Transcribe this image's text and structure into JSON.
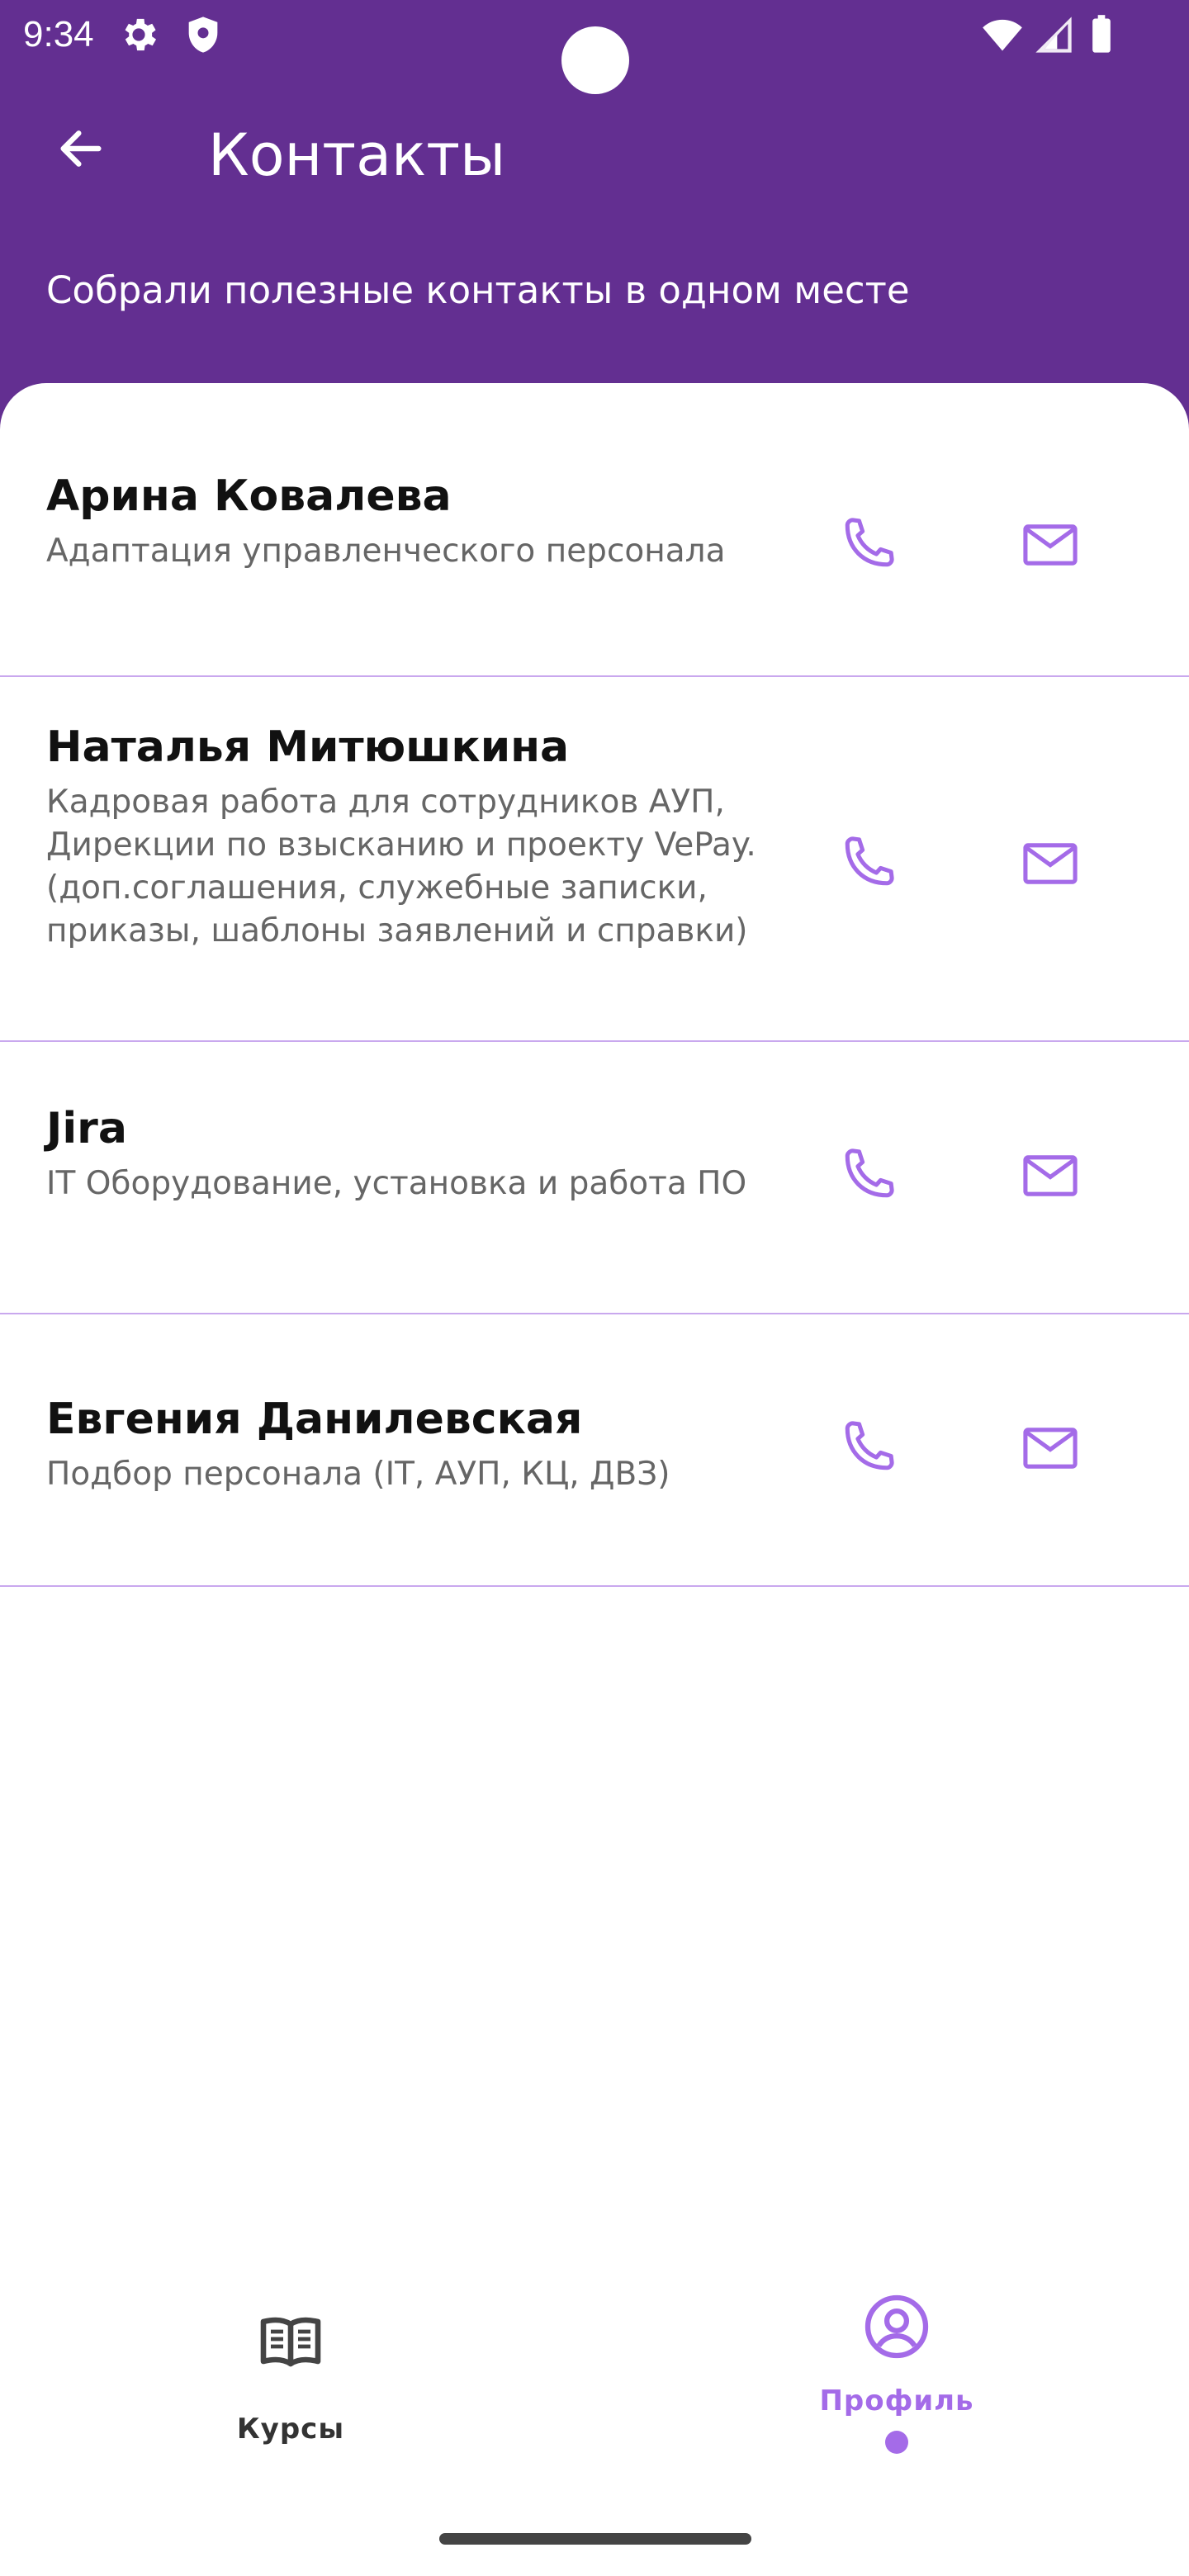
{
  "status_bar": {
    "time": "9:34",
    "icons": [
      "gear-icon",
      "shield-icon",
      "wifi-icon",
      "signal-icon",
      "battery-icon"
    ]
  },
  "header": {
    "title": "Контакты",
    "subtitle": "Собрали полезные контакты в одном месте",
    "back_icon": "arrow-left-icon"
  },
  "colors": {
    "header_bg": "#632F91",
    "accent": "#A46BE8",
    "divider": "#C9A8EE",
    "name_text": "#111111",
    "desc_text": "#666666"
  },
  "contacts": [
    {
      "name": "Арина Ковалева",
      "description": "Адаптация управленческого персонала"
    },
    {
      "name": "Наталья Митюшкина",
      "description": "Кадровая работа для сотрудников АУП, Дирекции по взысканию и проекту VePay. (доп.соглашения, служебные записки, приказы, шаблоны заявлений и справки)"
    },
    {
      "name": "Jira",
      "description": "IT Оборудование, установка и работа ПО"
    },
    {
      "name": "Евгения Данилевская",
      "description": "Подбор персонала (IT, АУП, КЦ, ДВЗ)"
    }
  ],
  "bottom_nav": {
    "items": [
      {
        "label": "Курсы",
        "icon": "book-icon",
        "active": false
      },
      {
        "label": "Профиль",
        "icon": "profile-icon",
        "active": true
      }
    ]
  }
}
